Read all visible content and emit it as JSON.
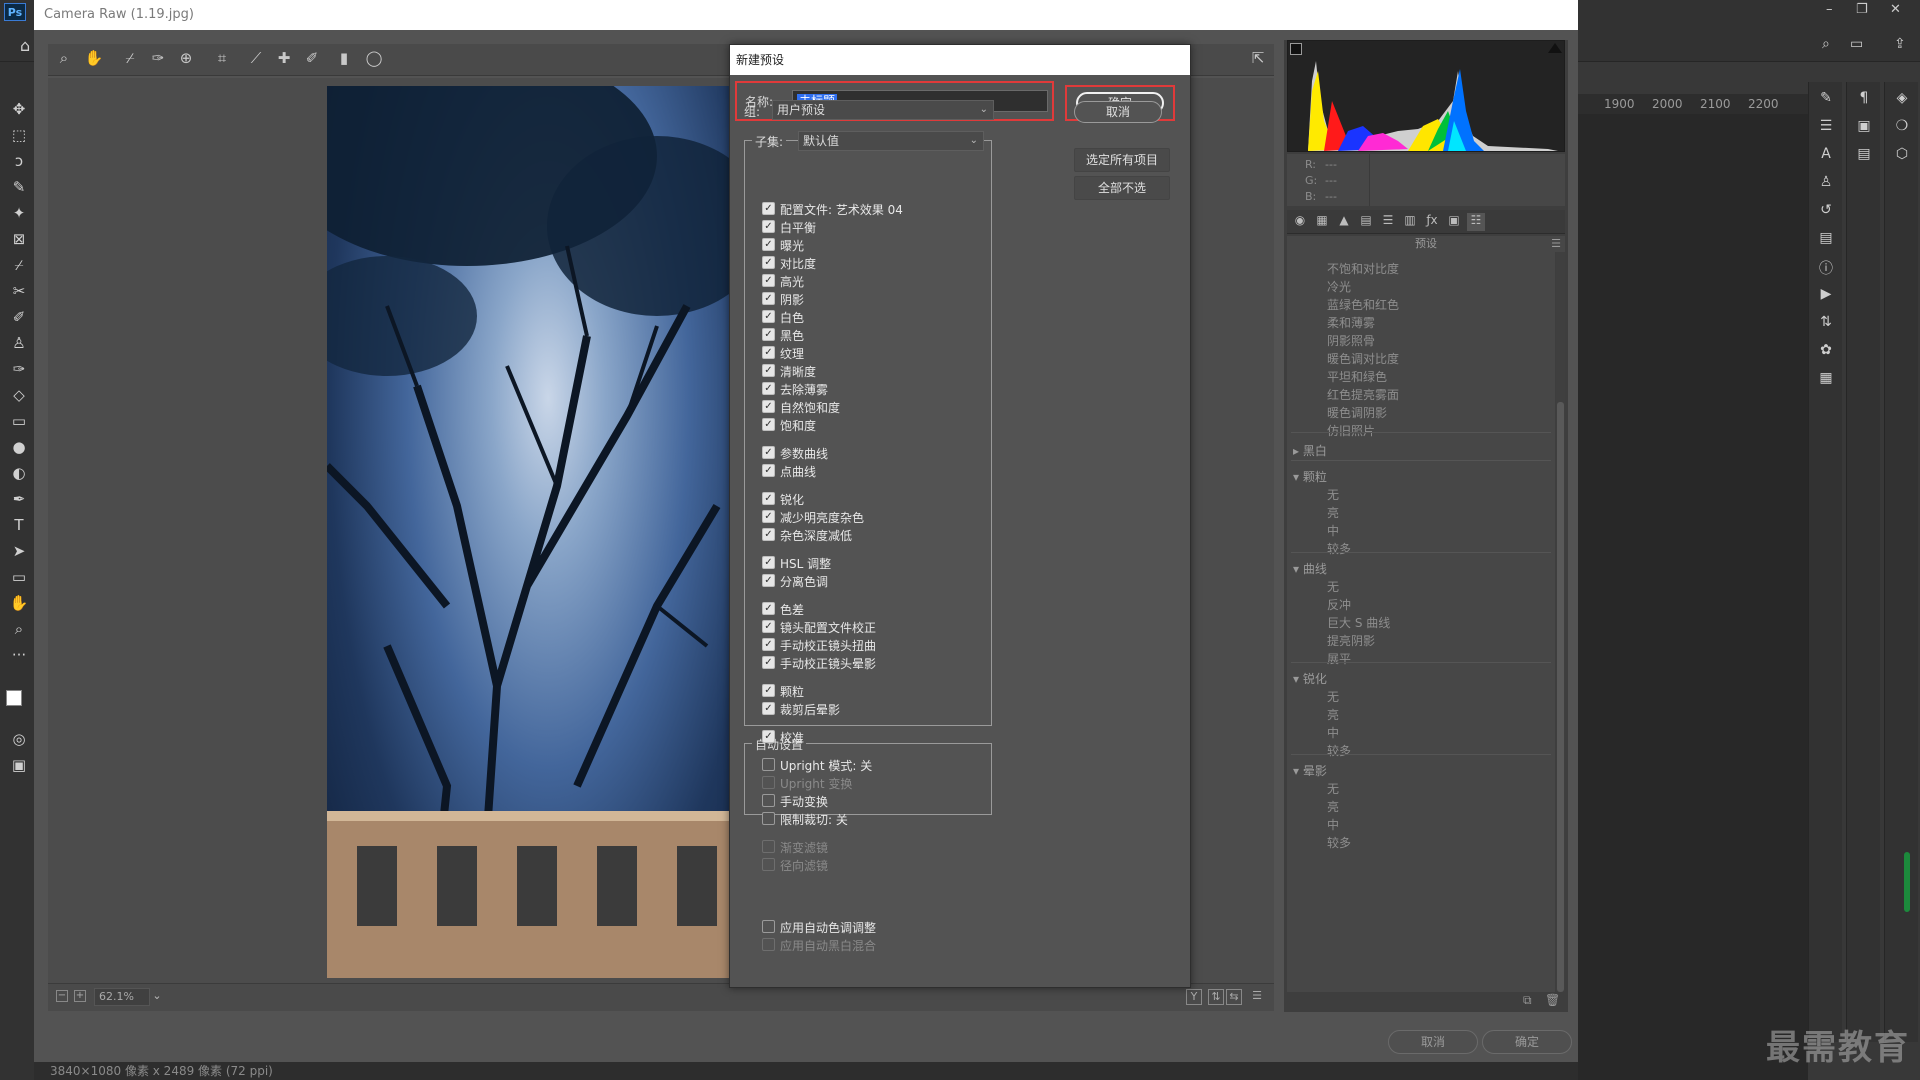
{
  "ps": {
    "logo": "Ps",
    "ruler_ticks": [
      "1900",
      "2000",
      "2100",
      "2200"
    ]
  },
  "window": {
    "title": "Camera Raw (1.19.jpg)",
    "status": "3840×1080 像素 x 2489 像素 (72 ppi)"
  },
  "preview": {
    "zoom": "62.1%"
  },
  "footer": {
    "cancel": "取消",
    "ok": "确定"
  },
  "watermark": "最需教育",
  "histogram": {
    "r_label": "R:",
    "g_label": "G:",
    "b_label": "B:",
    "r_value": "---",
    "g_value": "---",
    "b_value": "---"
  },
  "presets": {
    "header": "预设",
    "items_top": [
      "不饱和对比度",
      "冷光",
      "蓝绿色和红色",
      "柔和薄雾",
      "阴影照骨",
      "暖色调对比度",
      "平坦和绿色",
      "红色提亮雾面",
      "暖色调阴影",
      "仿旧照片"
    ],
    "group_bw": "黑白",
    "group_grain": "颗粒",
    "grain_items": [
      "无",
      "亮",
      "中",
      "较多"
    ],
    "group_curve": "曲线",
    "curve_items": [
      "无",
      "反冲",
      "巨大 S 曲线",
      "提亮阴影",
      "展平"
    ],
    "group_sharpen": "锐化",
    "sharpen_items": [
      "无",
      "亮",
      "中",
      "较多"
    ],
    "group_vignette": "晕影",
    "vignette_items": [
      "无",
      "亮",
      "中",
      "较多"
    ]
  },
  "dialog": {
    "title": "新建预设",
    "name_label": "名称:",
    "name_value": "未标题",
    "group_label": "组:",
    "group_value": "用户预设",
    "subset_label": "子集:",
    "subset_value": "默认值",
    "ok": "确定",
    "cancel": "取消",
    "select_all": "选定所有项目",
    "select_none": "全部不选",
    "auto_legend": "自动设置",
    "checks": [
      {
        "label": "配置文件: 艺术效果 04",
        "checked": true,
        "disabled": false
      },
      {
        "label": "白平衡",
        "checked": true,
        "disabled": false
      },
      {
        "label": "曝光",
        "checked": true,
        "disabled": false
      },
      {
        "label": "对比度",
        "checked": true,
        "disabled": false
      },
      {
        "label": "高光",
        "checked": true,
        "disabled": false
      },
      {
        "label": "阴影",
        "checked": true,
        "disabled": false
      },
      {
        "label": "白色",
        "checked": true,
        "disabled": false
      },
      {
        "label": "黑色",
        "checked": true,
        "disabled": false
      },
      {
        "label": "纹理",
        "checked": true,
        "disabled": false
      },
      {
        "label": "清晰度",
        "checked": true,
        "disabled": false
      },
      {
        "label": "去除薄雾",
        "checked": true,
        "disabled": false
      },
      {
        "label": "自然饱和度",
        "checked": true,
        "disabled": false
      },
      {
        "label": "饱和度",
        "checked": true,
        "disabled": false
      },
      {
        "label": "参数曲线",
        "checked": true,
        "disabled": false
      },
      {
        "label": "点曲线",
        "checked": true,
        "disabled": false
      },
      {
        "label": "锐化",
        "checked": true,
        "disabled": false
      },
      {
        "label": "减少明亮度杂色",
        "checked": true,
        "disabled": false
      },
      {
        "label": "杂色深度减低",
        "checked": true,
        "disabled": false
      },
      {
        "label": "HSL 调整",
        "checked": true,
        "disabled": false
      },
      {
        "label": "分离色调",
        "checked": true,
        "disabled": false
      },
      {
        "label": "色差",
        "checked": true,
        "disabled": false
      },
      {
        "label": "镜头配置文件校正",
        "checked": true,
        "disabled": false
      },
      {
        "label": "手动校正镜头扭曲",
        "checked": true,
        "disabled": false
      },
      {
        "label": "手动校正镜头晕影",
        "checked": true,
        "disabled": false
      },
      {
        "label": "颗粒",
        "checked": true,
        "disabled": false
      },
      {
        "label": "裁剪后晕影",
        "checked": true,
        "disabled": false
      },
      {
        "label": "校准",
        "checked": true,
        "disabled": false
      },
      {
        "label": "Upright 模式: 关",
        "checked": false,
        "disabled": false
      },
      {
        "label": "Upright 变换",
        "checked": false,
        "disabled": true
      },
      {
        "label": "手动变换",
        "checked": false,
        "disabled": false
      },
      {
        "label": "限制裁切: 关",
        "checked": false,
        "disabled": false
      },
      {
        "label": "渐变滤镜",
        "checked": false,
        "disabled": true
      },
      {
        "label": "径向滤镜",
        "checked": false,
        "disabled": true
      }
    ],
    "auto_checks": [
      {
        "label": "应用自动色调调整",
        "checked": false,
        "disabled": false
      },
      {
        "label": "应用自动黑白混合",
        "checked": false,
        "disabled": true
      }
    ]
  },
  "colors": {
    "highlight_red": "#e03a3a",
    "selection_blue": "#2f6ff0"
  }
}
